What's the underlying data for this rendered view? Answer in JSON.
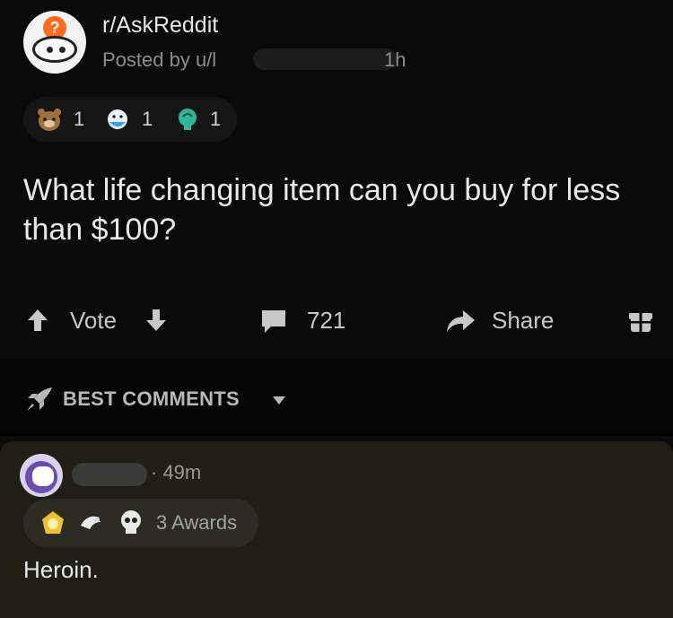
{
  "post": {
    "subreddit": "r/AskReddit",
    "posted_by": "Posted by u/l",
    "time": "1h",
    "awards": [
      {
        "icon": "bear-award-icon",
        "count": "1"
      },
      {
        "icon": "wholesome-award-icon",
        "count": "1"
      },
      {
        "icon": "brain-award-icon",
        "count": "1"
      }
    ],
    "title": "What life changing item can you buy for less than $100?"
  },
  "actions": {
    "vote_label": "Vote",
    "comment_count": "721",
    "share_label": "Share"
  },
  "sort": {
    "label": "BEST COMMENTS"
  },
  "comment": {
    "time": "· 49m",
    "awards_label": "3 Awards",
    "text": "Heroin."
  },
  "colors": {
    "background": "#0a0a0a",
    "comment_bg": "#201f16",
    "text": "#e8e8e8",
    "muted": "#8a8c8e"
  }
}
